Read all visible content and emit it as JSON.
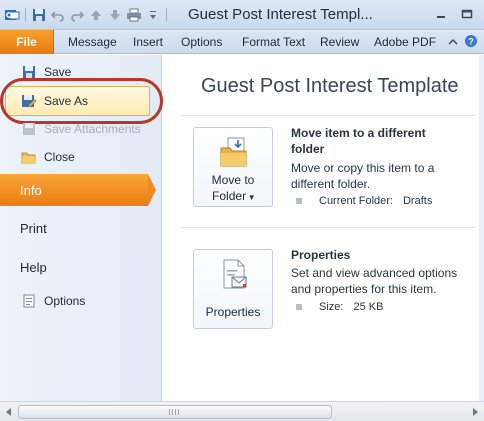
{
  "window": {
    "title": "Guest Post Interest Templ..."
  },
  "ribbon": {
    "file_label": "File",
    "tabs": [
      "Message",
      "Insert",
      "Options",
      "Format Text",
      "Review",
      "Adobe PDF"
    ]
  },
  "backstage_nav": {
    "save": "Save",
    "save_as": "Save As",
    "save_attachments": "Save Attachments",
    "close": "Close",
    "info": "Info",
    "print": "Print",
    "help": "Help",
    "options": "Options"
  },
  "info_page": {
    "title": "Guest Post Interest Template",
    "move": {
      "button_line1": "Move to",
      "button_line2": "Folder",
      "button_dropdown_glyph": "▾",
      "heading_line1": "Move item to a different",
      "heading_line2": "folder",
      "desc_line1": "Move or copy this item to a",
      "desc_line2": "different folder.",
      "current_folder_label": "Current Folder:",
      "current_folder_value": "Drafts"
    },
    "properties": {
      "button_label": "Properties",
      "heading": "Properties",
      "desc_line1": "Set and view advanced options",
      "desc_line2": "and properties for this item.",
      "size_label": "Size:",
      "size_value": "25 KB"
    }
  },
  "icons": {
    "save": "save-icon",
    "save_as": "save-as-icon",
    "save_attachments": "save-attachments-icon",
    "close": "folder-close-icon",
    "options": "options-icon",
    "move_folder": "move-to-folder-icon",
    "properties": "properties-icon"
  },
  "colors": {
    "file_tab": "#e8790f",
    "info_active": "#f08a20",
    "highlight_ring": "#b8362a",
    "title_bar": "#c9d9ee"
  }
}
